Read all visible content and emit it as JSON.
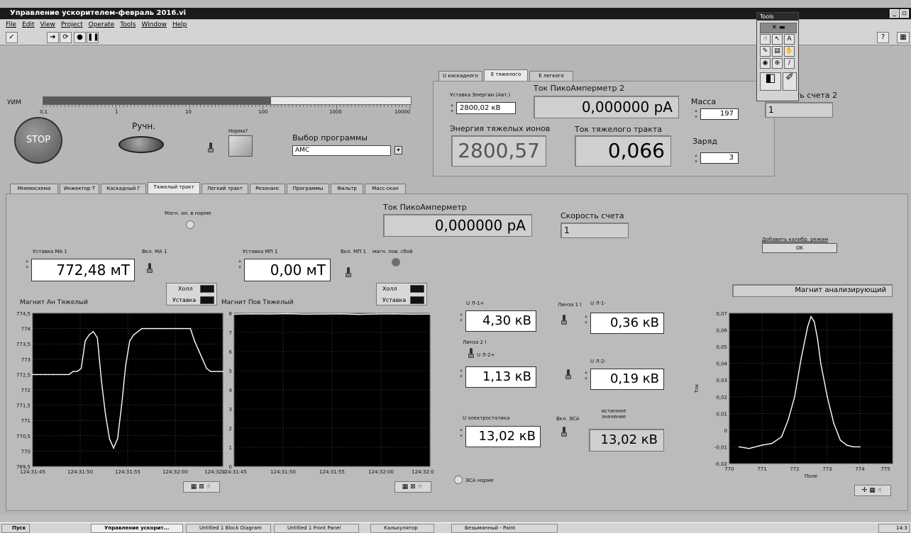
{
  "window": {
    "title": "Управление ускорителем-февраль 2016.vi"
  },
  "menu": [
    "File",
    "Edit",
    "View",
    "Project",
    "Operate",
    "Tools",
    "Window",
    "Help"
  ],
  "tools_palette": {
    "title": "Tools"
  },
  "top": {
    "uim_label": "УИМ",
    "uim_ticks": [
      "0,1",
      "1",
      "10",
      "100",
      "1000",
      "10000"
    ],
    "uim_fill_fraction": 0.62,
    "stop_label": "STOP",
    "manual_label": "Ручн.",
    "norm_label": "Норма?",
    "program_label": "Выбор программы",
    "program_value": "AMC"
  },
  "energy_tabs": {
    "tabs": [
      "U каскадного",
      "E тяжелого",
      "E легкого"
    ],
    "active": 1,
    "setpoint_label": "Уставка Энергии (Авт.)",
    "setpoint_value": "2800,02 кВ",
    "picoam2_label": "Ток ПикоАмперметр 2",
    "picoam2_value": "0,000000 pA",
    "mass_label": "Масса",
    "mass_value": "197",
    "count2_label": "Скорость счета 2",
    "count2_value": "1",
    "heavy_energy_label": "Энергия тяжелых ионов",
    "heavy_energy_value": "2800,57",
    "heavy_current_label": "Ток тяжелого тракта",
    "heavy_current_value": "0,066",
    "charge_label": "Заряд",
    "charge_value": "3"
  },
  "main_tabs": {
    "tabs": [
      "Мнемосхема",
      "Инжектор Т",
      "Каскадный Г",
      "Тяжелый тракт",
      "Легкий тракт",
      "Резонанс",
      "Программы",
      "Фильтр",
      "Масс-скан"
    ],
    "active": 3
  },
  "heavy": {
    "magn_norm_label": "Магн. ан. в норме",
    "picoam_label": "Ток ПикоАмперметр",
    "picoam_value": "0,000000 pA",
    "count_label": "Скорость счета",
    "count_value": "1",
    "calib_label": "Добавить калибр. режим",
    "ok_label": "OK",
    "ma1_label": "Уставка МА 1",
    "ma1_value": "772,48 мТ",
    "ma1_switch_label": "Вкл. МА 1",
    "mp1_label": "Уставка МП 1",
    "mp1_value": "0,00 мТ",
    "mp1_switch_label": "Вкл. МП 1",
    "mp_fail_label": "магн. пов. сбой",
    "legend_hall": "Холл",
    "legend_setpoint": "Уставка",
    "graph1_title": "Магнит Ан Тяжелый",
    "graph2_title": "Магнит Пов Тяжелый",
    "ul1p_label": "U Л-1+",
    "ul1p_value": "4,30 кВ",
    "lens1_label": "Линза 1 I",
    "ul1m_label": "U Л-1-",
    "ul1m_value": "0,36 кВ",
    "lens2_label": "Линза 2 I",
    "ul2p_label": "U Л-2+",
    "ul2p_value": "1,13 кВ",
    "ul2m_label": "U Л-2-",
    "ul2m_value": "0,19 кВ",
    "uesa_label": "U электростатика",
    "uesa_value": "13,02 кВ",
    "esa_switch_label": "Вкл. ЭСА",
    "true_value_label": "истинное значение",
    "true_value": "13,02 кВ",
    "esa_norm_label": "ЭСА норме",
    "analyzer_label": "Магнит анализирующий"
  },
  "chart_data": [
    {
      "type": "line",
      "title": "Магнит Ан Тяжелый",
      "x_ticks": [
        "124:31:45",
        "124:31:50",
        "124:31:55",
        "124:32:00",
        "124:32:0"
      ],
      "y_ticks": [
        "774,5",
        "774",
        "773,5",
        "773",
        "772,5",
        "772",
        "771,5",
        "771",
        "770,5",
        "770",
        "769,5"
      ],
      "ylim": [
        769.5,
        774.5
      ],
      "series": [
        {
          "name": "Холл",
          "values": [
            772.5,
            772.5,
            772.5,
            772.5,
            772.5,
            772.5,
            772.5,
            772.5,
            772.5,
            772.5,
            772.6,
            772.6,
            772.7,
            773.6,
            773.8,
            773.9,
            773.7,
            772.3,
            771.2,
            770.4,
            770.1,
            770.4,
            771.5,
            772.8,
            773.6,
            773.8,
            773.9,
            774.0,
            774.0,
            774.0,
            774.0,
            774.0,
            774.0,
            774.0,
            774.0,
            774.0,
            774.0,
            774.0,
            774.0,
            774.0,
            773.6,
            773.3,
            773.0,
            772.7,
            772.6,
            772.6,
            772.6,
            772.6
          ]
        }
      ]
    },
    {
      "type": "line",
      "title": "Магнит Пов Тяжелый",
      "x_ticks": [
        "124:31:45",
        "124:31:50",
        "124:31:55",
        "124:32:00",
        "124:32:0"
      ],
      "y_ticks": [
        "8",
        "7",
        "6",
        "5",
        "4",
        "3",
        "2",
        "1",
        "0"
      ],
      "ylim": [
        0,
        8
      ],
      "series": [
        {
          "name": "Холл",
          "values": [
            7.95,
            7.97,
            7.96,
            7.98,
            7.95,
            7.96,
            7.97,
            7.94,
            7.96,
            7.97,
            7.95,
            7.96
          ]
        }
      ]
    },
    {
      "type": "line",
      "title": "Магнит анализирующий",
      "xlabel": "Поле",
      "ylabel": "Ток",
      "x_ticks": [
        "770",
        "771",
        "772",
        "773",
        "774",
        "775"
      ],
      "y_ticks": [
        "0,07",
        "0,06",
        "0,05",
        "0,04",
        "0,03",
        "0,02",
        "0,01",
        "0",
        "-0,01",
        "-0,02"
      ],
      "xlim": [
        770,
        775
      ],
      "ylim": [
        -0.02,
        0.07
      ],
      "x": [
        770.3,
        770.6,
        771.0,
        771.3,
        771.6,
        771.8,
        772.0,
        772.2,
        772.4,
        772.5,
        772.6,
        772.7,
        772.8,
        773.0,
        773.2,
        773.4,
        773.6,
        773.8,
        774.0
      ],
      "series": [
        {
          "name": "",
          "values": [
            -0.01,
            -0.011,
            -0.009,
            -0.008,
            -0.004,
            0.006,
            0.02,
            0.043,
            0.062,
            0.068,
            0.065,
            0.055,
            0.04,
            0.02,
            0.004,
            -0.006,
            -0.009,
            -0.01,
            -0.01
          ]
        }
      ]
    }
  ],
  "taskbar": {
    "start": "Пуск",
    "tasks": [
      "Управление ускорит...",
      "Untitled 1 Block Diagram",
      "Untitled 1 Front Panel",
      "Калькулятор",
      "Безымянный - Paint"
    ],
    "clock": "14:3"
  }
}
